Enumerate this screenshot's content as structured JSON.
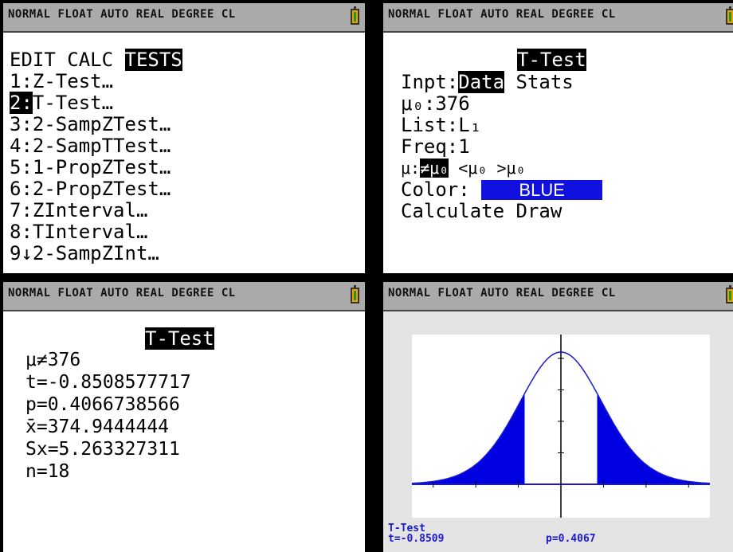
{
  "status": "NORMAL FLOAT AUTO REAL DEGREE CL",
  "menu": {
    "tabs": [
      "EDIT",
      "CALC",
      "TESTS"
    ],
    "items": [
      {
        "key": "1:",
        "label": "Z-Test…"
      },
      {
        "key": "2:",
        "label": "T-Test…"
      },
      {
        "key": "3:",
        "label": "2-SampZTest…"
      },
      {
        "key": "4:",
        "label": "2-SampTTest…"
      },
      {
        "key": "5:",
        "label": "1-PropZTest…"
      },
      {
        "key": "6:",
        "label": "2-PropZTest…"
      },
      {
        "key": "7:",
        "label": "ZInterval…"
      },
      {
        "key": "8:",
        "label": "TInterval…"
      },
      {
        "key": "9↓",
        "label": "2-SampZInt…"
      }
    ]
  },
  "ttest_input": {
    "title": "T-Test",
    "inpt_label": "Inpt:",
    "inpt_selected": "Data",
    "inpt_other": "Stats",
    "mu0": "μ₀:376",
    "list": "List:L₁",
    "freq": "Freq:1",
    "mu_label": "μ:",
    "mu_selected": "≠μ₀",
    "mu_opt2": "<μ₀",
    "mu_opt3": ">μ₀",
    "color_label": "Color:",
    "color_value": "BLUE",
    "calculate": "Calculate",
    "draw": "Draw"
  },
  "ttest_result": {
    "title": "T-Test",
    "lines": [
      "μ≠376",
      "t=-0.8508577717",
      "p=0.4066738566",
      "x̄=374.9444444",
      "Sx=5.263327311",
      "n=18"
    ]
  },
  "graph": {
    "label_title": "T-Test",
    "label_t": "t=-0.8509",
    "label_p": "p=0.4067",
    "t_value": -0.8509,
    "df": 17,
    "xlim": [
      -3.5,
      3.5
    ],
    "curve_color": "#1a1ad0",
    "fill_color": "#0000e0"
  }
}
